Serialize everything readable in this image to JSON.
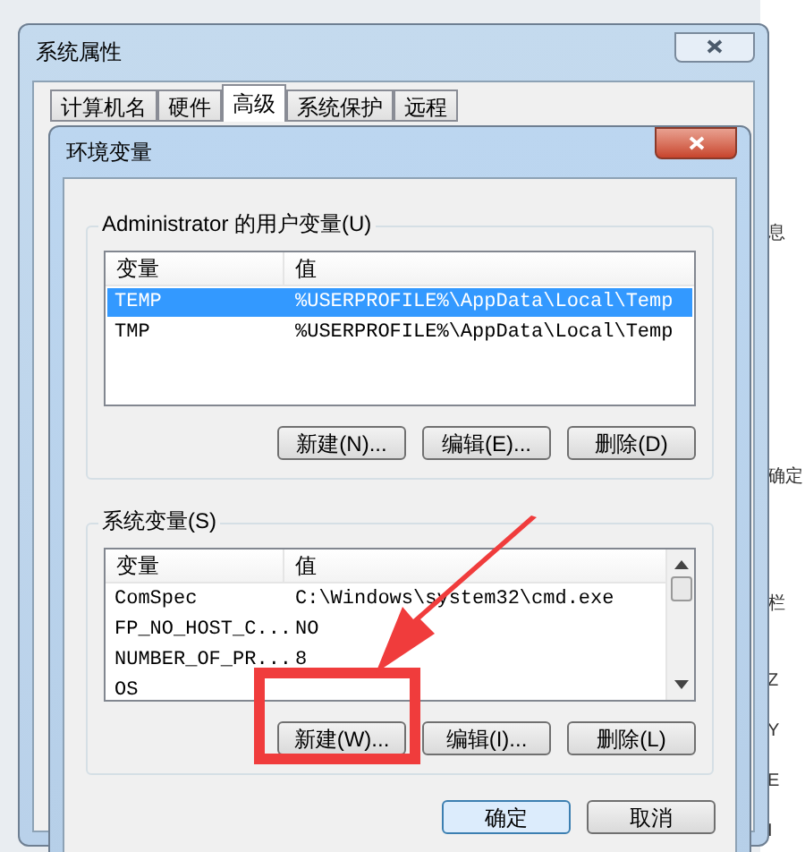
{
  "outer_window": {
    "title": "系统属性",
    "tabs": [
      {
        "label": "计算机名",
        "selected": false
      },
      {
        "label": "硬件",
        "selected": false
      },
      {
        "label": "高级",
        "selected": true
      },
      {
        "label": "系统保护",
        "selected": false
      },
      {
        "label": "远程",
        "selected": false
      }
    ]
  },
  "dialog": {
    "title": "环境变量",
    "user_vars": {
      "label": "Administrator 的用户变量(U)",
      "columns": [
        "变量",
        "值"
      ],
      "rows": [
        {
          "name": "TEMP",
          "value": "%USERPROFILE%\\AppData\\Local\\Temp",
          "selected": true
        },
        {
          "name": "TMP",
          "value": "%USERPROFILE%\\AppData\\Local\\Temp",
          "selected": false
        }
      ],
      "buttons": [
        "新建(N)...",
        "编辑(E)...",
        "删除(D)"
      ]
    },
    "system_vars": {
      "label": "系统变量(S)",
      "columns": [
        "变量",
        "值"
      ],
      "rows": [
        {
          "name": "ComSpec",
          "value": "C:\\Windows\\system32\\cmd.exe",
          "selected": false
        },
        {
          "name": "FP_NO_HOST_C...",
          "value": "NO",
          "selected": false
        },
        {
          "name": "NUMBER_OF_PR...",
          "value": "8",
          "selected": false
        },
        {
          "name": "OS",
          "selected": false
        }
      ],
      "buttons": [
        "新建(W)...",
        "编辑(I)...",
        "删除(L)"
      ]
    },
    "buttons": [
      "确定",
      "取消"
    ]
  },
  "background_fragments": [
    "息",
    "确定",
    "栏",
    "Z",
    "Y",
    "E",
    "I"
  ]
}
